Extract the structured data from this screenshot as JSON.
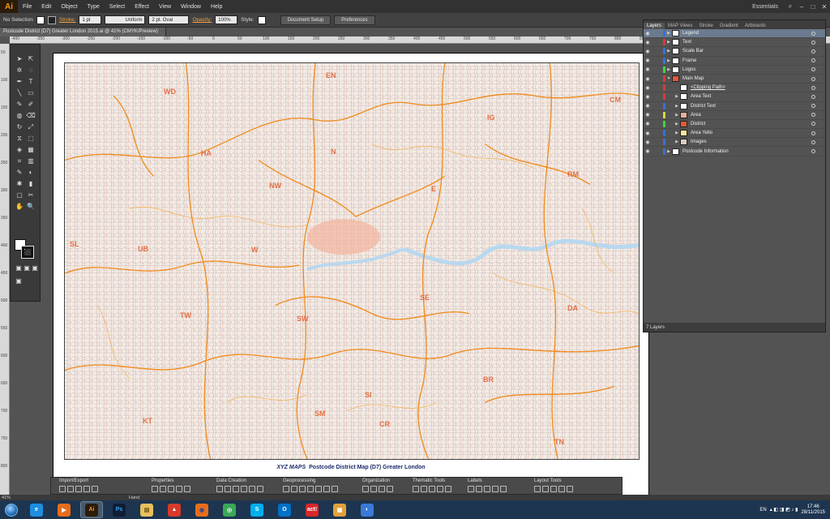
{
  "menubar": {
    "logo": "Ai",
    "items": [
      "File",
      "Edit",
      "Object",
      "Type",
      "Select",
      "Effect",
      "View",
      "Window",
      "Help"
    ],
    "workspace": "Essentials"
  },
  "controlbar": {
    "selection": "No Selection",
    "stroke_label": "Stroke:",
    "stroke_weight": "1 pt",
    "profile": "Uniform",
    "brush": "2 pt. Oval",
    "opacity_label": "Opacity:",
    "opacity": "100%",
    "style_label": "Style:",
    "document_setup": "Document Setup",
    "preferences": "Preferences"
  },
  "document": {
    "tab_title": "Postcode District (D7) Greater London 2015.ai @ 41% (CMYK/Preview)"
  },
  "ruler": {
    "h_ticks": [
      "-400",
      "-350",
      "-300",
      "-250",
      "-200",
      "-150",
      "-100",
      "-50",
      "0",
      "50",
      "100",
      "150",
      "200",
      "250",
      "300",
      "350",
      "400",
      "450",
      "500",
      "550",
      "600",
      "650",
      "700",
      "750",
      "800",
      "850",
      "900",
      "950",
      "1000",
      "1050",
      "1100",
      "1150",
      "1200"
    ],
    "v_ticks": [
      "50",
      "100",
      "150",
      "200",
      "250",
      "300",
      "350",
      "400",
      "450",
      "500",
      "550",
      "600",
      "650",
      "700",
      "750",
      "800"
    ]
  },
  "map": {
    "labels": [
      "WD",
      "EN",
      "CM",
      "IG",
      "HA",
      "N",
      "RM",
      "NW",
      "E",
      "SL",
      "UB",
      "W",
      "SE",
      "TW",
      "SW",
      "DA",
      "BR",
      "SM",
      "CR",
      "KT",
      "TN"
    ],
    "footer_brand": "XYZ MAPS",
    "footer_title": "Postcode District Map  (D7)  Greater London"
  },
  "layers": {
    "tabs": [
      "Layers",
      "MAP Views",
      "Stroke",
      "Gradient",
      "Artboards"
    ],
    "rows": [
      {
        "name": "Legend",
        "color": "#3a6fd8",
        "selected": true
      },
      {
        "name": "Text",
        "color": "#d83a3a",
        "selected": false
      },
      {
        "name": "Scale Bar",
        "color": "#3a6fd8",
        "selected": false
      },
      {
        "name": "Frame",
        "color": "#3a6fd8",
        "selected": false
      },
      {
        "name": "Logos",
        "color": "#3ad83a",
        "selected": false
      },
      {
        "name": "Main Map",
        "color": "#d83a3a",
        "selected": false
      },
      {
        "name": "<Clipping Path>",
        "color": "#d83a3a",
        "selected": false
      },
      {
        "name": "Area Text",
        "color": "#d83a3a",
        "selected": false
      },
      {
        "name": "District Text",
        "color": "#3a6fd8",
        "selected": false
      },
      {
        "name": "Area",
        "color": "#d8d83a",
        "selected": false
      },
      {
        "name": "District",
        "color": "#3ad83a",
        "selected": false
      },
      {
        "name": "Area Yello",
        "color": "#3a6fd8",
        "selected": false
      },
      {
        "name": "Images",
        "color": "#3a6fd8",
        "selected": false
      },
      {
        "name": "Postcode Information",
        "color": "#3a6fd8",
        "selected": false
      }
    ],
    "footer_count": "7 Layers"
  },
  "status": {
    "zoom": "41%",
    "tool": "Hand"
  },
  "map_toolbar": {
    "groups": [
      "Import/Export",
      "Properties",
      "Data Creation",
      "Geoprocessing",
      "Organization",
      "Thematic Tools",
      "Labels",
      "Layout Tools"
    ]
  },
  "taskbar": {
    "apps": [
      "IE",
      "Media",
      "Ai",
      "Ps",
      "Files",
      "Tool",
      "Firefox",
      "Chrome",
      "Skype",
      "Outlook",
      "act!",
      "Doc",
      "App"
    ],
    "lang": "EN",
    "time": "17:46",
    "date": "28/11/2015"
  }
}
